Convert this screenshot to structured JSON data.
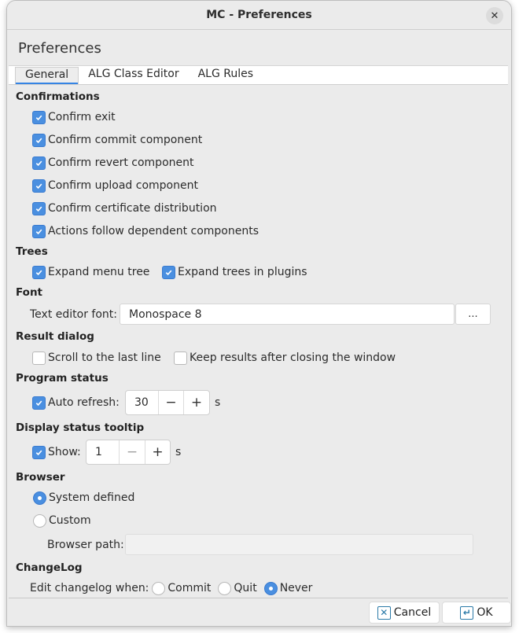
{
  "window": {
    "title": "MC - Preferences",
    "close_icon": "close-icon"
  },
  "heading": "Preferences",
  "tabs": [
    {
      "label": "General",
      "active": true
    },
    {
      "label": "ALG Class Editor",
      "active": false
    },
    {
      "label": "ALG Rules",
      "active": false
    }
  ],
  "sections": {
    "confirmations": {
      "title": "Confirmations",
      "items": [
        {
          "label": "Confirm exit",
          "checked": true
        },
        {
          "label": "Confirm commit component",
          "checked": true
        },
        {
          "label": "Confirm revert component",
          "checked": true
        },
        {
          "label": "Confirm upload component",
          "checked": true
        },
        {
          "label": "Confirm certificate distribution",
          "checked": true
        },
        {
          "label": "Actions follow dependent components",
          "checked": true
        }
      ]
    },
    "trees": {
      "title": "Trees",
      "items": [
        {
          "label": "Expand menu tree",
          "checked": true
        },
        {
          "label": "Expand trees in plugins",
          "checked": true
        }
      ]
    },
    "font": {
      "title": "Font",
      "label": "Text editor font:",
      "value": "Monospace 8",
      "button_label": "..."
    },
    "result_dialog": {
      "title": "Result dialog",
      "items": [
        {
          "label": "Scroll to the last line",
          "checked": false
        },
        {
          "label": "Keep results after closing the window",
          "checked": false
        }
      ]
    },
    "program_status": {
      "title": "Program status",
      "checkbox_label": "Auto refresh:",
      "checked": true,
      "value": "30",
      "minus": "−",
      "plus": "+",
      "unit": "s"
    },
    "status_tooltip": {
      "title": "Display status tooltip",
      "checkbox_label": "Show:",
      "checked": true,
      "value": "1",
      "minus": "−",
      "plus": "+",
      "unit": "s"
    },
    "browser": {
      "title": "Browser",
      "options": [
        {
          "label": "System defined",
          "selected": true
        },
        {
          "label": "Custom",
          "selected": false
        }
      ],
      "path_label": "Browser path:",
      "path_value": ""
    },
    "changelog": {
      "title": "ChangeLog",
      "label": "Edit changelog when:",
      "options": [
        {
          "label": "Commit",
          "selected": false
        },
        {
          "label": "Quit",
          "selected": false
        },
        {
          "label": "Never",
          "selected": true
        }
      ]
    }
  },
  "footer": {
    "cancel_label": "Cancel",
    "ok_label": "OK"
  },
  "colors": {
    "accent": "#4a8fe0",
    "icon_teal": "#2a7aa8"
  }
}
